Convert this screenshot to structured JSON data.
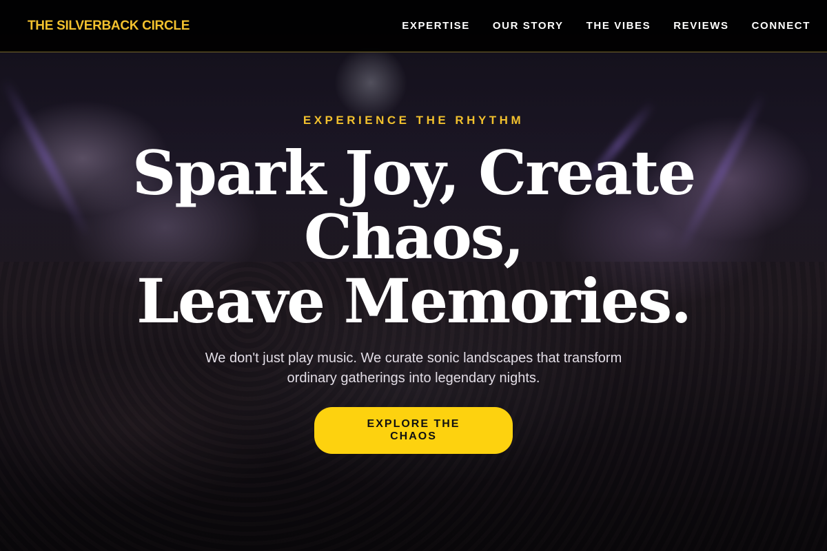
{
  "nav": {
    "brand": "THE SILVERBACK CIRCLE",
    "links": [
      {
        "label": "EXPERTISE"
      },
      {
        "label": "OUR STORY"
      },
      {
        "label": "THE VIBES"
      },
      {
        "label": "REVIEWS"
      },
      {
        "label": "CONNECT"
      }
    ]
  },
  "hero": {
    "eyebrow": "EXPERIENCE THE RHYTHM",
    "headline": {
      "line1": "Spark Joy, Create",
      "line2": "Chaos,",
      "line3": "Leave Memories."
    },
    "subtext": "We don't just play music. We curate sonic landscapes that transform ordinary gatherings into legendary nights.",
    "cta_label": "EXPLORE THE CHAOS"
  },
  "colors": {
    "accent": "#f2c12e",
    "button": "#fdd20f",
    "navbar_bg": "#000000",
    "text": "#ffffff"
  }
}
